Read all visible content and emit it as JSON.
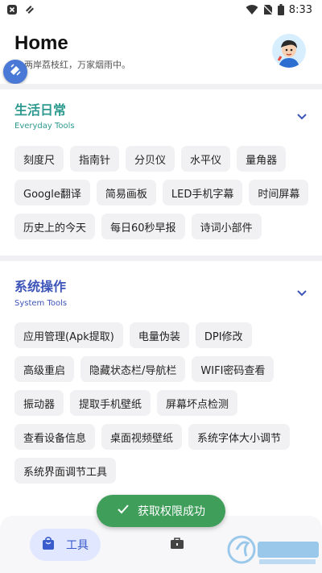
{
  "status_bar": {
    "time": "8:33"
  },
  "header": {
    "title": "Home",
    "subtitle": "两岸荔枝红，万家烟雨中。"
  },
  "sections": [
    {
      "title": "生活日常",
      "subtitle": "Everyday Tools",
      "accent": "#2e9a8f",
      "items": [
        "刻度尺",
        "指南针",
        "分贝仪",
        "水平仪",
        "量角器",
        "Google翻译",
        "简易画板",
        "LED手机字幕",
        "时间屏幕",
        "历史上的今天",
        "每日60秒早报",
        "诗词小部件"
      ]
    },
    {
      "title": "系统操作",
      "subtitle": "System Tools",
      "accent": "#3d54b8",
      "items": [
        "应用管理(Apk提取)",
        "电量伪装",
        "DPI修改",
        "高级重启",
        "隐藏状态栏/导航栏",
        "WIFI密码查看",
        "振动器",
        "提取手机壁纸",
        "屏幕坏点检测",
        "查看设备信息",
        "桌面视频壁纸",
        "系统字体大小调节",
        "系统界面调节工具"
      ]
    }
  ],
  "toast": {
    "text": "获取权限成功"
  },
  "bottom_nav": {
    "tools_label": "工具"
  },
  "colors": {
    "toast_bg": "#3e9e5a",
    "nav_active_bg": "#e0e7ff",
    "nav_active_fg": "#3a5bcc"
  },
  "icons": [
    "close-box-icon",
    "slash-icon",
    "wifi-icon",
    "no-sim-icon",
    "battery-icon",
    "float-edit-icon",
    "chevron-down-icon",
    "check-icon",
    "shopping-bag-icon",
    "briefcase-icon"
  ]
}
